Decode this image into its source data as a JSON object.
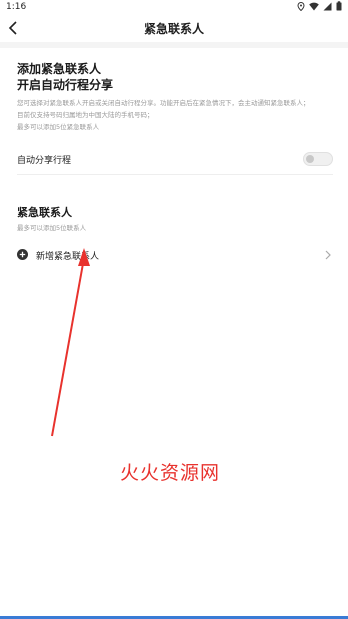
{
  "status_bar": {
    "time": "1:16",
    "icons": [
      "location-icon",
      "wifi-icon",
      "signal-icon",
      "battery-icon"
    ]
  },
  "nav": {
    "title": "紧急联系人",
    "back_icon": "chevron-left-icon"
  },
  "intro": {
    "title_line1": "添加紧急联系人",
    "title_line2": "开启自动行程分享",
    "desc_lines": [
      "您可选择对紧急联系人开启或关闭自动行程分享。功能开启后在紧急情况下，会主动通知紧急联系人；",
      "目前仅支持号码归属地为中国大陆的手机号码；",
      "最多可以添加5位紧急联系人"
    ]
  },
  "auto_share": {
    "label": "自动分享行程",
    "enabled": false
  },
  "contacts": {
    "title": "紧急联系人",
    "subtitle": "最多可以添加5位联系人",
    "add_label": "新增紧急联系人"
  },
  "watermark": {
    "text": "火火资源网"
  },
  "colors": {
    "annotation_red": "#e8322d",
    "accent_blue": "#3a7bd5",
    "muted_text": "#9a9a9a"
  }
}
